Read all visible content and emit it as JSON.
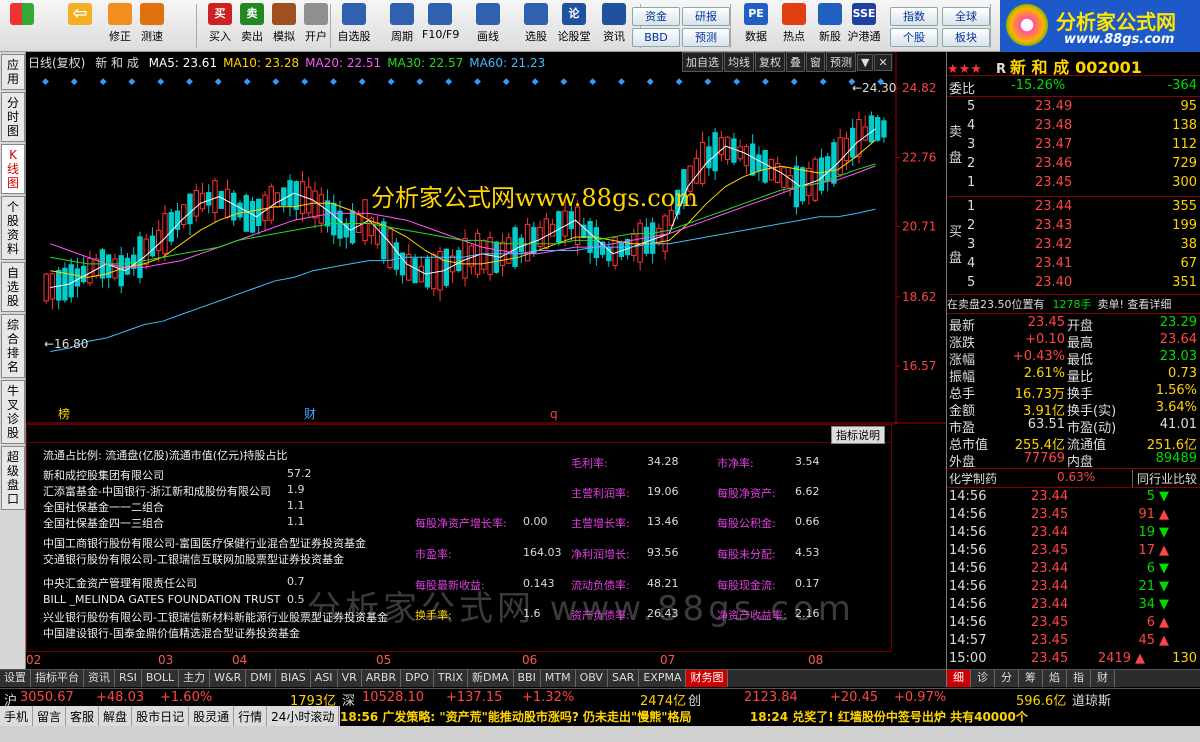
{
  "toolbar": {
    "buttons": [
      {
        "label": "",
        "icon": "grid-icon"
      },
      {
        "label": "",
        "icon": "back-arrow-icon"
      },
      {
        "label": "修正"
      },
      {
        "label": "测速"
      },
      {
        "label": "买入",
        "icon_text": "买"
      },
      {
        "label": "卖出",
        "icon_text": "卖"
      },
      {
        "label": "模拟"
      },
      {
        "label": "开户"
      },
      {
        "label": "自选股"
      },
      {
        "label": "周期"
      },
      {
        "label": "F10/F9"
      },
      {
        "label": "画线"
      },
      {
        "label": "选股"
      },
      {
        "label": "论股堂",
        "icon_text": "论"
      },
      {
        "label": "资讯"
      },
      {
        "label": "数据",
        "icon_text": "PE"
      },
      {
        "label": "热点"
      },
      {
        "label": "新股"
      },
      {
        "label": "沪港通",
        "icon_text": "SSE"
      }
    ],
    "small_buttons": [
      "资金",
      "研报",
      "指数",
      "全球",
      "BBD",
      "预测",
      "个股",
      "板块"
    ],
    "logo_text": "分析家公式网",
    "logo_url": "www.88gs.com"
  },
  "left_tabs": [
    "应用",
    "分时图",
    "K线图",
    "个股资料",
    "自选股",
    "综合排名",
    "牛叉诊股",
    "超级盘口"
  ],
  "chart": {
    "period": "日线(复权)",
    "stock_name": "新 和 成",
    "ma": [
      {
        "label": "MA5: 23.61",
        "color": "#ffffff"
      },
      {
        "label": "MA10: 23.28",
        "color": "#ffd400"
      },
      {
        "label": "MA20: 22.51",
        "color": "#ff55ff"
      },
      {
        "label": "MA30: 22.57",
        "color": "#22dd22"
      },
      {
        "label": "MA60: 21.23",
        "color": "#44bbff"
      }
    ],
    "tools": [
      "加自选",
      "均线",
      "复权",
      "叠",
      "窗",
      "预测"
    ],
    "watermark": "分析家公式网www.88gs.com",
    "markers": [
      "榜",
      "财",
      "q"
    ],
    "annotation_high": "24.30",
    "annotation_low": "16.80"
  },
  "chart_data": {
    "type": "candlestick",
    "title": "",
    "y_ticks": [
      24.82,
      22.76,
      20.71,
      18.62,
      16.57
    ],
    "ylim": [
      15.5,
      25.3
    ],
    "x_months": [
      "02",
      "03",
      "04",
      "05",
      "06",
      "07",
      "08"
    ],
    "series": [
      {
        "name": "MA5",
        "values": [
          18.9,
          19.0,
          19.3,
          19.6,
          19.4,
          19.8,
          20.3,
          20.9,
          21.4,
          21.6,
          21.3,
          21.0,
          21.4,
          21.7,
          21.5,
          21.1,
          20.6,
          20.9,
          20.3,
          19.6,
          19.3,
          19.4,
          19.7,
          19.9,
          19.8,
          20.1,
          20.3,
          20.6,
          20.9,
          20.4,
          19.9,
          20.1,
          20.3,
          20.5,
          21.9,
          22.6,
          23.1,
          22.9,
          22.6,
          22.3,
          21.9,
          22.1,
          22.6,
          23.2,
          23.61
        ]
      },
      {
        "name": "MA10",
        "values": [
          19.4,
          19.3,
          19.2,
          19.3,
          19.5,
          19.6,
          19.8,
          20.2,
          20.6,
          20.9,
          21.1,
          21.2,
          21.3,
          21.3,
          21.4,
          21.4,
          21.2,
          20.9,
          20.7,
          20.4,
          20.0,
          19.7,
          19.6,
          19.6,
          19.7,
          19.8,
          20.0,
          20.2,
          20.4,
          20.4,
          20.3,
          20.2,
          20.2,
          20.3,
          20.8,
          21.4,
          21.9,
          22.2,
          22.4,
          22.5,
          22.4,
          22.3,
          22.4,
          22.8,
          23.28
        ]
      },
      {
        "name": "MA20",
        "values": [
          20.2,
          20.0,
          19.8,
          19.6,
          19.5,
          19.5,
          19.6,
          19.7,
          19.9,
          20.1,
          20.3,
          20.5,
          20.7,
          20.9,
          21.0,
          21.1,
          21.1,
          21.1,
          21.0,
          20.9,
          20.7,
          20.5,
          20.3,
          20.1,
          20.0,
          19.9,
          19.9,
          20.0,
          20.1,
          20.1,
          20.2,
          20.3,
          20.4,
          20.5,
          20.7,
          20.9,
          21.1,
          21.3,
          21.5,
          21.7,
          21.9,
          22.0,
          22.1,
          22.3,
          22.51
        ]
      },
      {
        "name": "MA30",
        "values": [
          19.8,
          19.7,
          19.6,
          19.6,
          19.6,
          19.7,
          19.8,
          19.9,
          20.0,
          20.1,
          20.3,
          20.4,
          20.5,
          20.6,
          20.7,
          20.8,
          20.8,
          20.8,
          20.7,
          20.6,
          20.5,
          20.4,
          20.3,
          20.3,
          20.2,
          20.2,
          20.2,
          20.2,
          20.3,
          20.3,
          20.4,
          20.5,
          20.5,
          20.6,
          20.8,
          21.0,
          21.2,
          21.4,
          21.6,
          21.8,
          21.9,
          22.0,
          22.2,
          22.4,
          22.57
        ]
      },
      {
        "name": "MA60",
        "values": [
          17.0,
          17.1,
          17.3,
          17.4,
          17.6,
          17.8,
          17.9,
          18.1,
          18.3,
          18.5,
          18.7,
          18.9,
          19.1,
          19.2,
          19.4,
          19.5,
          19.6,
          19.7,
          19.7,
          19.8,
          19.8,
          19.8,
          19.8,
          19.9,
          19.9,
          19.9,
          20.0,
          20.0,
          20.0,
          20.1,
          20.1,
          20.1,
          20.2,
          20.2,
          20.3,
          20.4,
          20.5,
          20.6,
          20.7,
          20.8,
          20.9,
          21.0,
          21.0,
          21.1,
          21.23
        ]
      }
    ]
  },
  "f10": {
    "explain_btn": "指标说明",
    "holders_header": "流通占比例: 流通盘(亿股)流通市值(亿元)持股占比",
    "holders": [
      {
        "name": "新和成控股集团有限公司",
        "value": "57.2"
      },
      {
        "name": "汇添富基金-中国银行-浙江新和成股份有限公司",
        "value": "1.9"
      },
      {
        "name": "全国社保基金一一二组合",
        "value": "1.1"
      },
      {
        "name": "全国社保基金四一三组合",
        "value": "1.1"
      },
      {
        "name": "中国工商银行股份有限公司-富国医疗保健行业混合型证券投资基金",
        "value": ""
      },
      {
        "name": "交通银行股份有限公司-工银瑞信互联网加股票型证券投资基金",
        "value": ""
      },
      {
        "name": "中央汇金资产管理有限责任公司",
        "value": "0.7"
      },
      {
        "name": "BILL _MELINDA GATES FOUNDATION TRUST",
        "value": "0.5"
      },
      {
        "name": "兴业银行股份有限公司-工银瑞信新材料新能源行业股票型证券投资基金",
        "value": ""
      },
      {
        "name": "中国建设银行-国泰金鼎价值精选混合型证券投资基金",
        "value": ""
      }
    ],
    "metrics": [
      {
        "k": "毛利率:",
        "v": "34.28"
      },
      {
        "k": "市净率:",
        "v": "3.54"
      },
      {
        "k": "主营利润率:",
        "v": "19.06"
      },
      {
        "k": "每股净资产:",
        "v": "6.62"
      },
      {
        "k": "每股净资产增长率:",
        "v": "0.00"
      },
      {
        "k": "主营增长率:",
        "v": "13.46"
      },
      {
        "k": "每股公积金:",
        "v": "0.66"
      },
      {
        "k": "市盈率:",
        "v": "164.03"
      },
      {
        "k": "净利润增长:",
        "v": "93.56"
      },
      {
        "k": "每股未分配:",
        "v": "4.53"
      },
      {
        "k": "每股最新收益:",
        "v": "0.143"
      },
      {
        "k": "流动负债率:",
        "v": "48.21"
      },
      {
        "k": "每股现金流:",
        "v": "0.17"
      },
      {
        "k": "换手率:",
        "v": "1.6"
      },
      {
        "k": "资产负债率:",
        "v": "26.43"
      },
      {
        "k": "净资产收益率:",
        "v": "2.16"
      }
    ],
    "watermark": "分析家公式网 www.88gs.com"
  },
  "bottom_tabs": [
    "设置",
    "指标平台",
    "资讯",
    "RSI",
    "BOLL",
    "主力",
    "W&R",
    "DMI",
    "BIAS",
    "ASI",
    "VR",
    "ARBR",
    "DPO",
    "TRIX",
    "新DMA",
    "BBI",
    "MTM",
    "OBV",
    "SAR",
    "EXPMA",
    "财务图"
  ],
  "right": {
    "stars": "★★★",
    "r_flag": "R",
    "name": "新 和 成",
    "code": "002001",
    "weibi_label": "委比",
    "weibi_pct": "-15.26%",
    "weibi_diff": "-364",
    "sell_label": "卖盘",
    "buy_label": "买盘",
    "sells": [
      {
        "n": "5",
        "p": "23.49",
        "v": "95"
      },
      {
        "n": "4",
        "p": "23.48",
        "v": "138"
      },
      {
        "n": "3",
        "p": "23.47",
        "v": "112"
      },
      {
        "n": "2",
        "p": "23.46",
        "v": "729"
      },
      {
        "n": "1",
        "p": "23.45",
        "v": "300"
      }
    ],
    "buys": [
      {
        "n": "1",
        "p": "23.44",
        "v": "355"
      },
      {
        "n": "2",
        "p": "23.43",
        "v": "199"
      },
      {
        "n": "3",
        "p": "23.42",
        "v": "38"
      },
      {
        "n": "4",
        "p": "23.41",
        "v": "67"
      },
      {
        "n": "5",
        "p": "23.40",
        "v": "351"
      }
    ],
    "info_line": "在卖盘23.50位置有",
    "info_vol": "1278手",
    "info_tail": "卖单! 查看详细",
    "quotes": [
      {
        "k1": "最新",
        "v1": "23.45",
        "c1": "red",
        "k2": "开盘",
        "v2": "23.29",
        "c2": "green"
      },
      {
        "k1": "涨跌",
        "v1": "+0.10",
        "c1": "red",
        "k2": "最高",
        "v2": "23.64",
        "c2": "red"
      },
      {
        "k1": "涨幅",
        "v1": "+0.43%",
        "c1": "red",
        "k2": "最低",
        "v2": "23.03",
        "c2": "green"
      },
      {
        "k1": "振幅",
        "v1": "2.61%",
        "c1": "yellow",
        "k2": "量比",
        "v2": "0.73",
        "c2": "yellow"
      },
      {
        "k1": "总手",
        "v1": "16.73万",
        "c1": "yellow",
        "k2": "换手",
        "v2": "1.56%",
        "c2": "yellow"
      },
      {
        "k1": "金额",
        "v1": "3.91亿",
        "c1": "yellow",
        "k2": "换手(实)",
        "v2": "3.64%",
        "c2": "yellow"
      },
      {
        "k1": "市盈",
        "v1": "63.51",
        "c1": "white",
        "k2": "市盈(动)",
        "v2": "41.01",
        "c2": "white"
      },
      {
        "k1": "总市值",
        "v1": "255.4亿",
        "c1": "yellow",
        "k2": "流通值",
        "v2": "251.6亿",
        "c2": "yellow"
      },
      {
        "k1": "外盘",
        "v1": "77769",
        "c1": "red",
        "k2": "内盘",
        "v2": "89489",
        "c2": "green"
      }
    ],
    "industry": "化学制药",
    "industry_pct": "0.63%",
    "industry_btn": "同行业比较",
    "ticks": [
      {
        "t": "14:56",
        "p": "23.44",
        "v": "5",
        "d": "down"
      },
      {
        "t": "14:56",
        "p": "23.45",
        "v": "91",
        "d": "up"
      },
      {
        "t": "14:56",
        "p": "23.44",
        "v": "19",
        "d": "down"
      },
      {
        "t": "14:56",
        "p": "23.45",
        "v": "17",
        "d": "up"
      },
      {
        "t": "14:56",
        "p": "23.44",
        "v": "6",
        "d": "down"
      },
      {
        "t": "14:56",
        "p": "23.44",
        "v": "21",
        "d": "down"
      },
      {
        "t": "14:56",
        "p": "23.44",
        "v": "34",
        "d": "down"
      },
      {
        "t": "14:56",
        "p": "23.45",
        "v": "6",
        "d": "up"
      },
      {
        "t": "14:57",
        "p": "23.45",
        "v": "45",
        "d": "up"
      },
      {
        "t": "15:00",
        "p": "23.45",
        "v": "2419",
        "d": "up",
        "extra": "130"
      }
    ],
    "tabs": [
      "细",
      "诊",
      "分",
      "筹",
      "焰",
      "指",
      "财"
    ]
  },
  "status": {
    "sh_label": "沪",
    "sh_idx": "3050.67",
    "sh_chg": "+48.03",
    "sh_pct": "+1.60%",
    "sh_amt": "1793亿",
    "sz_label": "深",
    "sz_idx": "10528.10",
    "sz_chg": "+137.15",
    "sz_pct": "+1.32%",
    "sz_amt": "2474亿",
    "cy_label": "创",
    "cy_idx": "2123.84",
    "cy_chg": "+20.45",
    "cy_pct": "+0.97%",
    "dj_amt": "596.6亿",
    "dj_label": "道琼斯"
  },
  "status2": {
    "items": [
      "手机",
      "留言",
      "客服",
      "解盘",
      "股市日记",
      "股灵通",
      "行情",
      "24小时滚动"
    ],
    "ticker1": "18:56 广发策略: \"资产荒\"能推动股市涨吗? 仍未走出\"慢熊\"格局",
    "ticker2": "18:24 兑奖了! 红墙股份中签号出炉 共有40000个"
  },
  "colors": {
    "up": "#ff3333",
    "down": "#00cccc",
    "panel_border": "#880000"
  }
}
